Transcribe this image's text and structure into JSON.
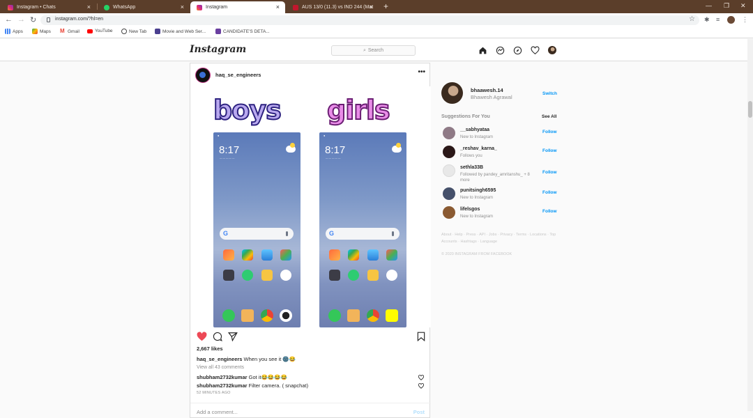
{
  "browser": {
    "tabs": [
      {
        "label": "Instagram • Chats",
        "icon": "instagram-icon",
        "active": false
      },
      {
        "label": "WhatsApp",
        "icon": "whatsapp-icon",
        "active": false
      },
      {
        "label": "Instagram",
        "icon": "instagram-icon",
        "active": true
      },
      {
        "label": "AUS 13/0 (11.3) vs IND 244 (Mat",
        "icon": "cricket-icon",
        "active": false
      }
    ],
    "url": "instagram.com/?hl=en",
    "bookmarks": [
      {
        "label": "Apps",
        "icon": "apps-grid-icon"
      },
      {
        "label": "Maps",
        "icon": "maps-icon"
      },
      {
        "label": "Gmail",
        "icon": "gmail-icon"
      },
      {
        "label": "YouTube",
        "icon": "youtube-icon"
      },
      {
        "label": "New Tab",
        "icon": "globe-icon"
      },
      {
        "label": "Movie and Web Ser...",
        "icon": "bookmark-site-icon"
      },
      {
        "label": "CANDIDATE'S DETA...",
        "icon": "bookmark-doc-icon"
      }
    ]
  },
  "header": {
    "logo": "Instagram",
    "search_placeholder": "Search"
  },
  "post": {
    "username": "haq_se_engineers",
    "more": "•••",
    "image": {
      "left_word": "boys",
      "right_word": "girls",
      "phone_time": "8:17",
      "left_dock_last_app": "camera",
      "right_dock_last_app": "snapchat"
    },
    "likes": "2,667 likes",
    "caption_user": "haq_se_engineers",
    "caption_text": "When you see it 🌚😂",
    "view_all": "View all 43 comments",
    "comments": [
      {
        "user": "shubham2732kumar",
        "text": "Got it😂😂😂😂"
      },
      {
        "user": "shubham2732kumar",
        "text": "Filter camera. ( snapchat)"
      }
    ],
    "time_ago": "52 MINUTES AGO",
    "add_comment_placeholder": "Add a comment...",
    "post_button": "Post",
    "like_color": "#ed4956"
  },
  "sidebar": {
    "me": {
      "username": "bhaawesh.14",
      "name": "Bhawesh Agrawal",
      "action": "Switch"
    },
    "suggestions_title": "Suggestions For You",
    "see_all": "See All",
    "suggestions": [
      {
        "username": "__sabhyataa",
        "sub": "New to Instagram",
        "action": "Follow",
        "color": "#8f7a86"
      },
      {
        "username": "_reshav_karna_",
        "sub": "Follows you",
        "action": "Follow",
        "color": "#2a1717"
      },
      {
        "username": "sethla33B",
        "sub": "Followed by pandey_amritanshu_ + 8 more",
        "action": "Follow",
        "color": "#dbdbdb"
      },
      {
        "username": "punitsingh6595",
        "sub": "New to Instagram",
        "action": "Follow",
        "color": "#45506a"
      },
      {
        "username": "lifelsgos",
        "sub": "New to Instagram",
        "action": "Follow",
        "color": "#8a5a32"
      }
    ],
    "footer": "About · Help · Press · API · Jobs · Privacy · Terms · Locations · Top Accounts · Hashtags · Language",
    "copyright": "© 2020 INSTAGRAM FROM FACEBOOK"
  },
  "colors": {
    "accent": "#0095f6",
    "chrome_frame": "#5b3e2a"
  }
}
